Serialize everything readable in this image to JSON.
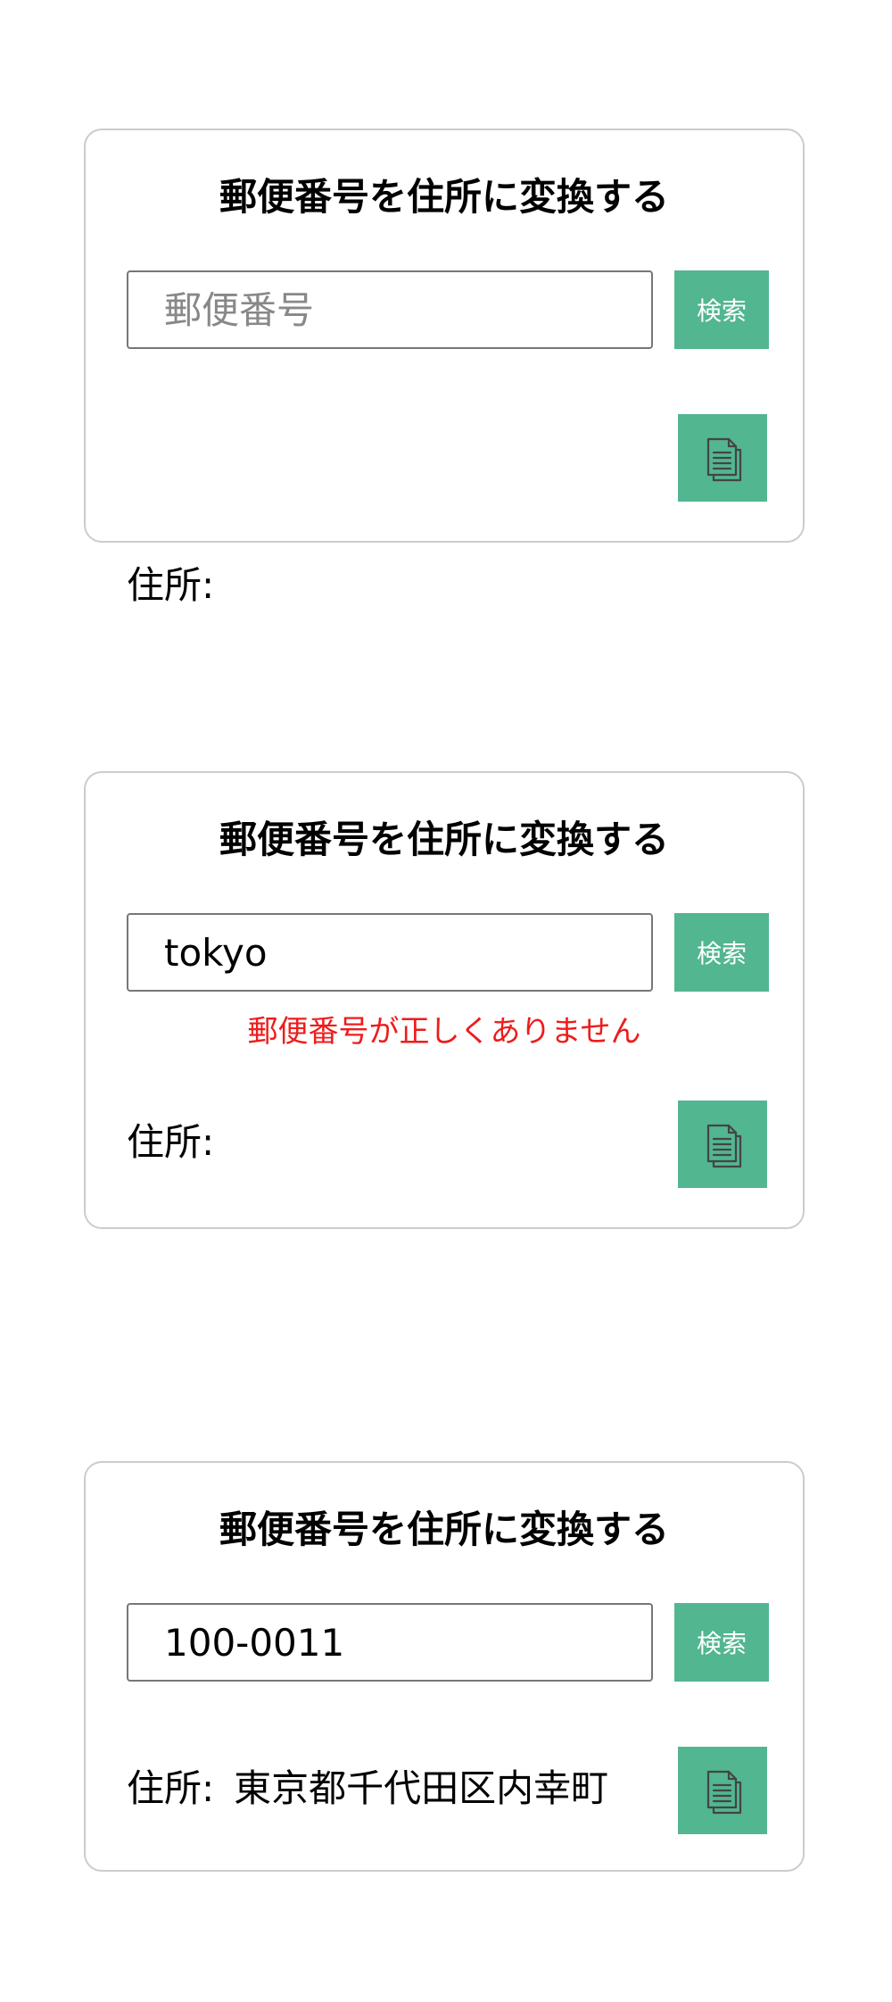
{
  "colors": {
    "accent": "#52b690",
    "error": "#ee1c1c",
    "border": "#cccccc"
  },
  "cards": [
    {
      "title": "郵便番号を住所に変換する",
      "input": {
        "value": "",
        "placeholder": "郵便番号"
      },
      "search_label": "検索",
      "error": "",
      "address_label": "住所:",
      "address_value": "",
      "copy_icon": "copy-icon"
    },
    {
      "title": "郵便番号を住所に変換する",
      "input": {
        "value": "tokyo",
        "placeholder": "郵便番号"
      },
      "search_label": "検索",
      "error": "郵便番号が正しくありません",
      "address_label": "住所:",
      "address_value": "",
      "copy_icon": "copy-icon"
    },
    {
      "title": "郵便番号を住所に変換する",
      "input": {
        "value": "100-0011",
        "placeholder": "郵便番号"
      },
      "search_label": "検索",
      "error": "",
      "address_label": "住所:",
      "address_value": "東京都千代田区内幸町",
      "copy_icon": "copy-icon"
    }
  ]
}
